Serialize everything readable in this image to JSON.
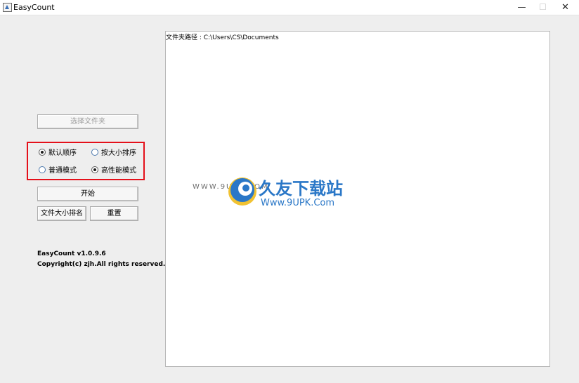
{
  "window": {
    "title": "EasyCount",
    "controls": {
      "minimize": "—",
      "maximize": "☐",
      "close": "✕"
    }
  },
  "sidebar": {
    "choose_folder_label": "选择文件夹",
    "radios": [
      {
        "label": "默认顺序",
        "checked": true
      },
      {
        "label": "按大小排序",
        "checked": false
      },
      {
        "label": "普通模式",
        "checked": false
      },
      {
        "label": "高性能模式",
        "checked": true
      }
    ],
    "start_label": "开始",
    "size_rank_label": "文件大小排名",
    "reset_label": "重置",
    "version": "EasyCount v1.0.9.6",
    "copyright": "Copyright(c) zjh.All rights reserved."
  },
  "output": {
    "path_line": "文件夹路径 : C:\\Users\\CS\\Documents"
  },
  "watermark": {
    "small": "WWW.9UPK.COM",
    "cn": "久友下载站",
    "url": "Www.9UPK.Com",
    "colors": {
      "blue": "#2a77c7",
      "yellow": "#f1c232"
    }
  }
}
